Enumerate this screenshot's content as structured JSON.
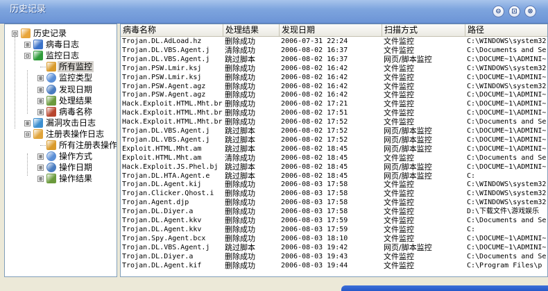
{
  "window": {
    "title": "历史记录",
    "controls": {
      "minimize": "⊖",
      "restore": "⊡",
      "close": "⊗"
    }
  },
  "tree": [
    {
      "label": "历史记录",
      "icon": "book-icon",
      "level": 0,
      "expander": "⊟"
    },
    {
      "label": "病毒日志",
      "icon": "log-icon",
      "level": 1,
      "expander": "⊞"
    },
    {
      "label": "监控日志",
      "icon": "umbrella-icon",
      "level": 1,
      "expander": "⊟"
    },
    {
      "label": "所有监控",
      "icon": "monitor-hand-icon",
      "level": 2,
      "expander": "",
      "selected": true
    },
    {
      "label": "监控类型",
      "icon": "magnifier-icon",
      "level": 2,
      "expander": "⊞"
    },
    {
      "label": "发现日期",
      "icon": "clock-icon",
      "level": 2,
      "expander": "⊞"
    },
    {
      "label": "处理结果",
      "icon": "checklist-icon",
      "level": 2,
      "expander": "⊞"
    },
    {
      "label": "病毒名称",
      "icon": "virus-doc-icon",
      "level": 2,
      "expander": "⊞"
    },
    {
      "label": "漏洞攻击日志",
      "icon": "exploit-icon",
      "level": 1,
      "expander": "⊞"
    },
    {
      "label": "注册表操作日志",
      "icon": "registry-book-icon",
      "level": 1,
      "expander": "⊟"
    },
    {
      "label": "所有注册表操作",
      "icon": "monitor-hand-icon",
      "level": 2,
      "expander": ""
    },
    {
      "label": "操作方式",
      "icon": "magnifier-icon",
      "level": 2,
      "expander": "⊞"
    },
    {
      "label": "操作日期",
      "icon": "clock-icon",
      "level": 2,
      "expander": "⊞"
    },
    {
      "label": "操作结果",
      "icon": "checklist-icon",
      "level": 2,
      "expander": "⊞"
    }
  ],
  "table": {
    "columns": [
      "病毒名称",
      "处理结果",
      "发现日期",
      "扫描方式",
      "路径"
    ],
    "rows": [
      [
        "Trojan.DL.AdLoad.hz",
        "删除成功",
        "2006-07-31 22:24",
        "文件监控",
        "C:\\WINDOWS\\system32"
      ],
      [
        "Trojan.DL.VBS.Agent.j",
        "清除成功",
        "2006-08-02 16:37",
        "文件监控",
        "C:\\Documents and Se"
      ],
      [
        "Trojan.DL.VBS.Agent.j",
        "跳过脚本",
        "2006-08-02 16:37",
        "网页/脚本监控",
        "C:\\DOCUME~1\\ADMINI~"
      ],
      [
        "Trojan.PSW.Lmir.ksj",
        "删除成功",
        "2006-08-02 16:42",
        "文件监控",
        "C:\\WINDOWS\\system32"
      ],
      [
        "Trojan.PSW.Lmir.ksj",
        "删除成功",
        "2006-08-02 16:42",
        "文件监控",
        "C:\\DOCUME~1\\ADMINI~"
      ],
      [
        "Trojan.PSW.Agent.agz",
        "删除成功",
        "2006-08-02 16:42",
        "文件监控",
        "C:\\WINDOWS\\system32"
      ],
      [
        "Trojan.PSW.Agent.agz",
        "删除成功",
        "2006-08-02 16:42",
        "文件监控",
        "C:\\DOCUME~1\\ADMINI~"
      ],
      [
        "Hack.Exploit.HTML.Mht.br",
        "删除成功",
        "2006-08-02 17:21",
        "文件监控",
        "C:\\DOCUME~1\\ADMINI~"
      ],
      [
        "Hack.Exploit.HTML.Mht.br",
        "删除成功",
        "2006-08-02 17:51",
        "文件监控",
        "C:\\DOCUME~1\\ADMINI~"
      ],
      [
        "Hack.Exploit.HTML.Mht.br",
        "删除成功",
        "2006-08-02 17:52",
        "文件监控",
        "C:\\Documents and Se"
      ],
      [
        "Trojan.DL.VBS.Agent.j",
        "跳过脚本",
        "2006-08-02 17:52",
        "网页/脚本监控",
        "C:\\DOCUME~1\\ADMINI~"
      ],
      [
        "Trojan.DL.VBS.Agent.j",
        "跳过脚本",
        "2006-08-02 17:52",
        "网页/脚本监控",
        "C:\\DOCUME~1\\ADMINI~"
      ],
      [
        "Exploit.HTML.Mht.am",
        "跳过脚本",
        "2006-08-02 18:45",
        "网页/脚本监控",
        "C:\\DOCUME~1\\ADMINI~"
      ],
      [
        "Exploit.HTML.Mht.am",
        "清除成功",
        "2006-08-02 18:45",
        "文件监控",
        "C:\\Documents and Se"
      ],
      [
        "Hack.Exploit.JS.Phel.bj",
        "跳过脚本",
        "2006-08-02 18:45",
        "网页/脚本监控",
        "C:\\DOCUME~1\\ADMINI~"
      ],
      [
        "Trojan.DL.HTA.Agent.e",
        "跳过脚本",
        "2006-08-02 18:45",
        "网页/脚本监控",
        "C:"
      ],
      [
        "Trojan.DL.Agent.kij",
        "删除成功",
        "2006-08-03 17:58",
        "文件监控",
        "C:\\WINDOWS\\system32"
      ],
      [
        "Trojan.Clicker.Qhost.i",
        "删除成功",
        "2006-08-03 17:58",
        "文件监控",
        "C:\\WINDOWS\\system32"
      ],
      [
        "Trojan.Agent.djp",
        "删除成功",
        "2006-08-03 17:58",
        "文件监控",
        "C:\\WINDOWS\\system32"
      ],
      [
        "Trojan.DL.Diyer.a",
        "删除成功",
        "2006-08-03 17:58",
        "文件监控",
        "D:\\下载文件\\游戏娱乐"
      ],
      [
        "Trojan.DL.Agent.kkv",
        "删除成功",
        "2006-08-03 17:59",
        "文件监控",
        "C:\\Documents and Se"
      ],
      [
        "Trojan.DL.Agent.kkv",
        "删除成功",
        "2006-08-03 17:59",
        "文件监控",
        "C:"
      ],
      [
        "Trojan.Spy.Agent.bcx",
        "删除成功",
        "2006-08-03 18:10",
        "文件监控",
        "C:\\DOCUME~1\\ADMINI~"
      ],
      [
        "Trojan.DL.VBS.Agent.j",
        "跳过脚本",
        "2006-08-03 19:42",
        "网页/脚本监控",
        "C:\\DOCUME~1\\ADMINI~"
      ],
      [
        "Trojan.DL.Diyer.a",
        "删除成功",
        "2006-08-03 19:43",
        "文件监控",
        "C:\\Documents and Se"
      ],
      [
        "Trojan.DL.Agent.kif",
        "删除成功",
        "2006-08-03 19:44",
        "文件监控",
        "C:\\Program Files\\p"
      ]
    ]
  },
  "mascot": {
    "icon": "penguin-icon"
  },
  "colors": {
    "titlebar": "#7ea5de",
    "window_bg": "#ece9d8",
    "panel_border": "#7f9db9",
    "selected_item": "#d6d3ce"
  }
}
